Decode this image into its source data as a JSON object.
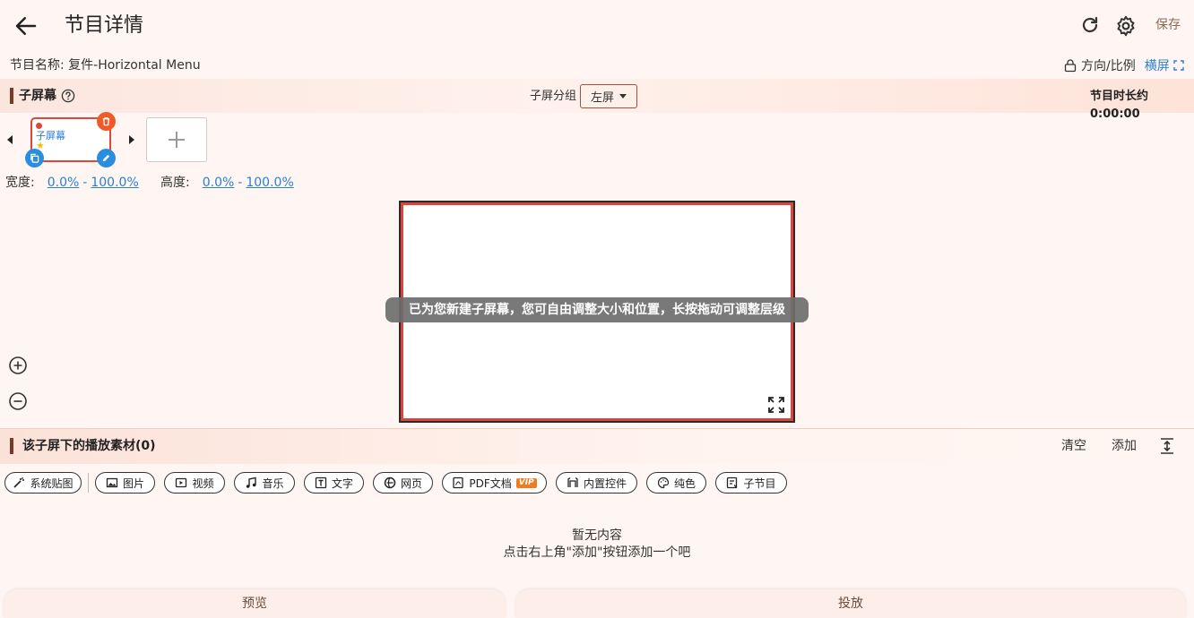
{
  "header": {
    "title": "节目详情",
    "save_label": "保存"
  },
  "program": {
    "name_label": "节目名称: 复件-Horizontal Menu",
    "orientation_label": "方向/比例",
    "orientation_value": "横屏"
  },
  "subscreen": {
    "title": "子屏幕",
    "group_label": "子屏分组",
    "group_value": "左屏",
    "duration": "节目时长约 0:00:00",
    "thumbnail_label": "子屏幕",
    "width_label": "宽度:",
    "width_from": "0.0%",
    "width_to": "100.0%",
    "height_label": "高度:",
    "height_from": "0.0%",
    "height_to": "100.0%",
    "range_sep": "-"
  },
  "canvas": {
    "toast": "已为您新建子屏幕，您可自由调整大小和位置，长按拖动可调整层级"
  },
  "materials": {
    "title": "该子屏下的播放素材(0)",
    "clear_label": "清空",
    "add_label": "添加",
    "chips": [
      {
        "label": "系统贴图",
        "icon": "magic-wand-icon"
      },
      {
        "label": "图片",
        "icon": "image-icon"
      },
      {
        "label": "视频",
        "icon": "video-icon"
      },
      {
        "label": "音乐",
        "icon": "music-icon"
      },
      {
        "label": "文字",
        "icon": "text-icon"
      },
      {
        "label": "网页",
        "icon": "web-icon"
      },
      {
        "label": "PDF文档",
        "icon": "pdf-icon",
        "badge": "VIP"
      },
      {
        "label": "内置控件",
        "icon": "widget-icon"
      },
      {
        "label": "纯色",
        "icon": "palette-icon"
      },
      {
        "label": "子节目",
        "icon": "subprogram-icon"
      }
    ],
    "empty_title": "暂无内容",
    "empty_hint": "点击右上角\"添加\"按钮添加一个吧"
  },
  "footer": {
    "preview_label": "预览",
    "cast_label": "投放"
  },
  "colors": {
    "accent_red": "#e0453a",
    "link_blue": "#2a7fd4",
    "delete_orange": "#ee5a2a",
    "action_blue": "#2a8ee0"
  }
}
